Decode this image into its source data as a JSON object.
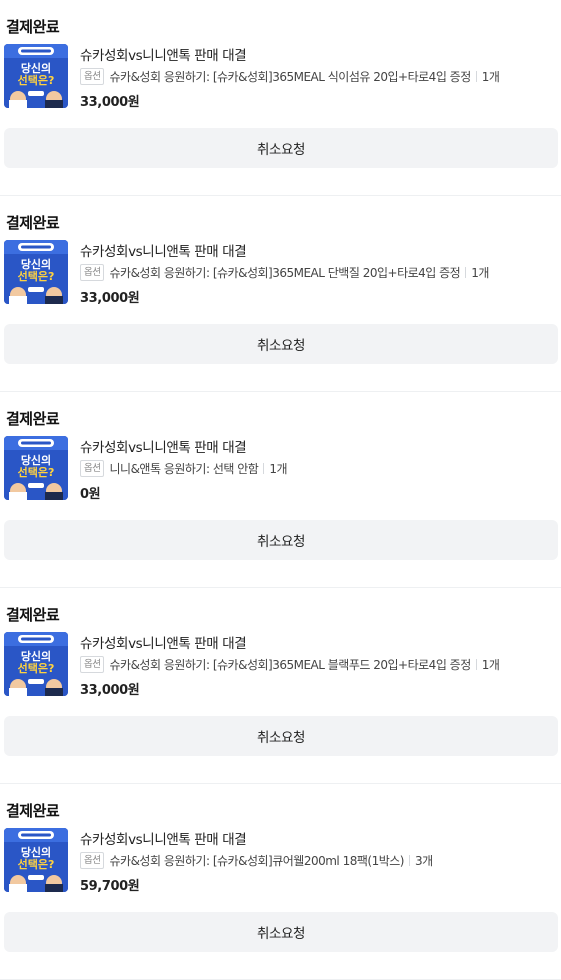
{
  "orders": [
    {
      "status": "결제완료",
      "product_name": "슈카성회vs니니앤톡 판매 대결",
      "option_badge": "옵션",
      "option_text": "슈카&성회 응원하기: [슈카&성회]365MEAL 식이섬유 20입+타로4입 증정",
      "quantity": "1개",
      "price": "33,000원",
      "cancel_label": "취소요청"
    },
    {
      "status": "결제완료",
      "product_name": "슈카성회vs니니앤톡 판매 대결",
      "option_badge": "옵션",
      "option_text": "슈카&성회 응원하기: [슈카&성회]365MEAL 단백질 20입+타로4입 증정",
      "quantity": "1개",
      "price": "33,000원",
      "cancel_label": "취소요청"
    },
    {
      "status": "결제완료",
      "product_name": "슈카성회vs니니앤톡 판매 대결",
      "option_badge": "옵션",
      "option_text": "니니&앤톡 응원하기: 선택 안함",
      "quantity": "1개",
      "price": "0원",
      "cancel_label": "취소요청"
    },
    {
      "status": "결제완료",
      "product_name": "슈카성회vs니니앤톡 판매 대결",
      "option_badge": "옵션",
      "option_text": "슈카&성회 응원하기: [슈카&성회]365MEAL 블랙푸드 20입+타로4입 증정",
      "quantity": "1개",
      "price": "33,000원",
      "cancel_label": "취소요청"
    },
    {
      "status": "결제완료",
      "product_name": "슈카성회vs니니앤톡 판매 대결",
      "option_badge": "옵션",
      "option_text": "슈카&성회 응원하기: [슈카&성회]큐어웰200ml 18팩(1박스)",
      "quantity": "3개",
      "price": "59,700원",
      "cancel_label": "취소요청"
    }
  ],
  "thumbnail": {
    "line1": "당신의",
    "line2": "선택은?",
    "colors": {
      "bg": "#2a56c6",
      "accent": "#ffd23f",
      "text": "#ffffff"
    }
  }
}
